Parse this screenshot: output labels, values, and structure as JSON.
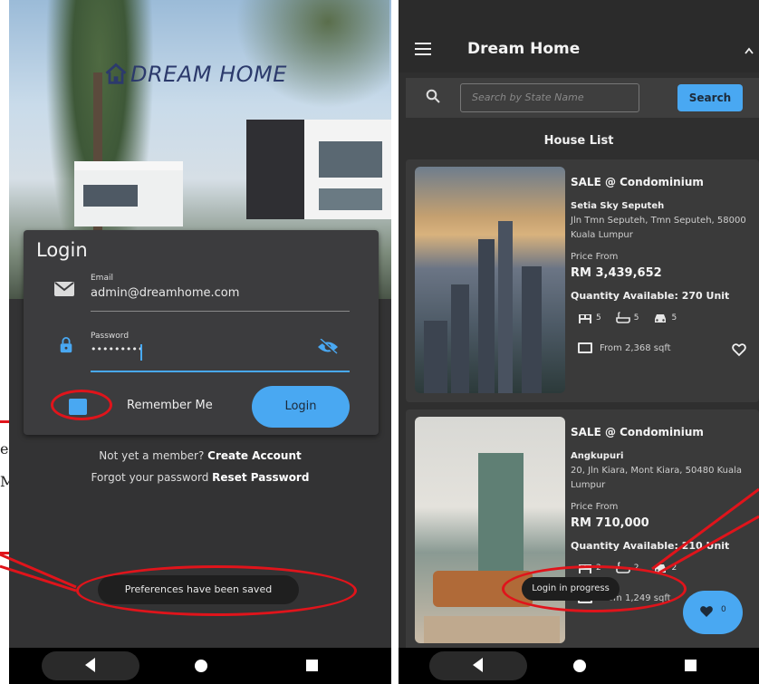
{
  "annotation": {
    "fragment_1": "en",
    "fragment_2": "Me"
  },
  "login_screen": {
    "brand": "DREAM HOME",
    "card_title": "Login",
    "email_label": "Email",
    "email_value": "admin@dreamhome.com",
    "password_label": "Password",
    "password_value": "•••••••••",
    "remember_label": "Remember Me",
    "login_button": "Login",
    "member_prompt": "Not yet a member?",
    "create_account": "Create Account",
    "forgot_prompt": "Forgot your password",
    "reset_password": "Reset Password",
    "toast": "Preferences have been saved"
  },
  "list_screen": {
    "app_title": "Dream Home",
    "search_placeholder": "Search by State Name",
    "search_button": "Search",
    "section_title": "House List",
    "listings": [
      {
        "title": "SALE @ Condominium",
        "name": "Setia Sky Seputeh",
        "address": "Jln Tmn Seputeh, Tmn Seputeh, 58000 Kuala Lumpur",
        "price_label": "Price From",
        "price": "RM 3,439,652",
        "quantity": "Quantity Available: 270 Unit",
        "bedrooms": "5",
        "bathrooms": "5",
        "parking": "5",
        "area": "From 2,368 sqft"
      },
      {
        "title": "SALE @ Condominium",
        "name": "Angkupuri",
        "address": "20, Jln Kiara, Mont Kiara, 50480 Kuala Lumpur",
        "price_label": "Price From",
        "price": "RM 710,000",
        "quantity": "Quantity Available: 210 Unit",
        "bedrooms": "2",
        "bathrooms": "2",
        "parking": "2",
        "area": "From 1,249 sqft"
      }
    ],
    "toast": "Login in progress",
    "favourites_count": "0"
  },
  "colors": {
    "accent": "#49a8f2",
    "annotation": "#e0141b",
    "surface": "#3a3a3a"
  }
}
